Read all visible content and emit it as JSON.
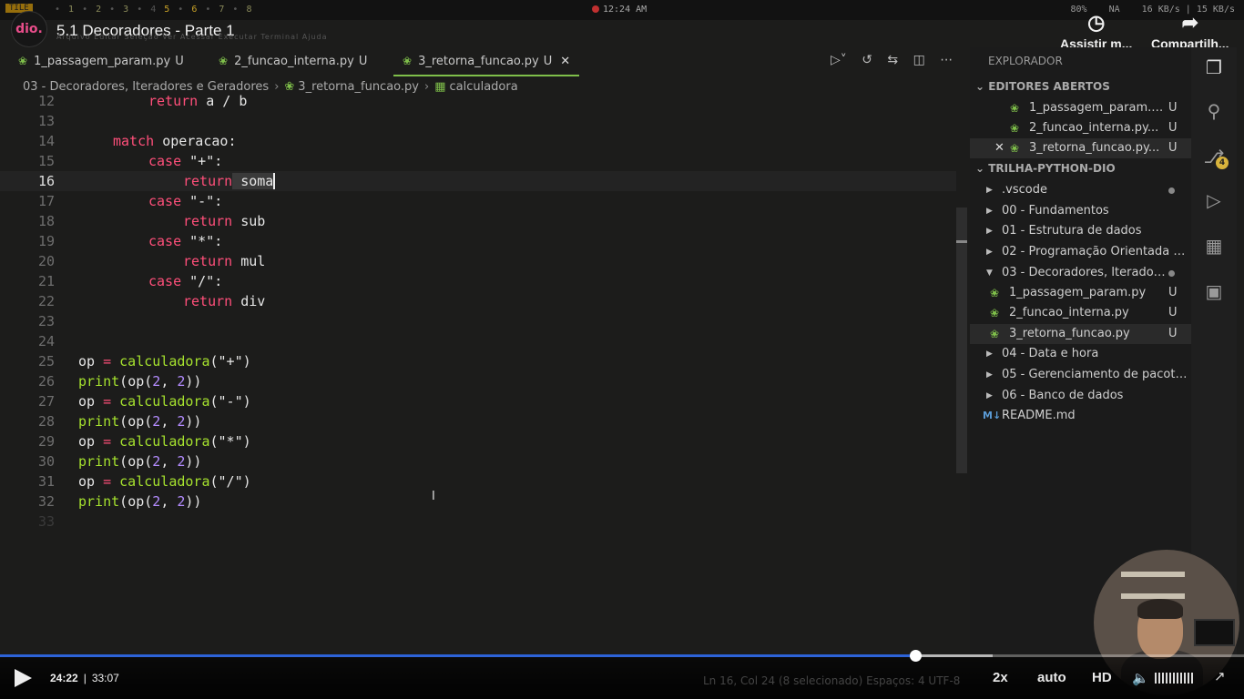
{
  "topbar": {
    "workspace_tag": "TILE",
    "workspaces": [
      "•",
      "1",
      "•",
      "2",
      "•",
      "3",
      "•",
      "4",
      "5",
      "•",
      "6",
      "•",
      "7",
      "•",
      "8"
    ],
    "clock": "12:24 AM",
    "cpu": "80%",
    "na": "NA",
    "net": "16 KB/s | 15 KB/s"
  },
  "video": {
    "title": "5.1 Decoradores - Parte 1",
    "ghost_menu": "Arquivo  Editar  Seleção  Ver  Acessar  Executar  Terminal  Ajuda",
    "watch_later": "Assistir m...",
    "share": "Compartilh..."
  },
  "tabs": [
    {
      "label": "1_passagem_param.py",
      "status": "U"
    },
    {
      "label": "2_funcao_interna.py",
      "status": "U"
    },
    {
      "label": "3_retorna_funcao.py",
      "status": "U",
      "close": "✕"
    }
  ],
  "breadcrumb": {
    "folder": "03 - Decoradores, Iteradores e Geradores",
    "file": "3_retorna_funcao.py",
    "symbol": "calculadora"
  },
  "code": {
    "line_numbers": [
      "12",
      "13",
      "14",
      "15",
      "16",
      "17",
      "18",
      "19",
      "20",
      "21",
      "22",
      "23",
      "24",
      "25",
      "26",
      "27",
      "28",
      "29",
      "30",
      "31",
      "32",
      "33"
    ],
    "kw_return": "return",
    "kw_match": "match",
    "kw_case": "case",
    "frag_12": " a / b",
    "var_operacao": "operacao",
    "colon": ":",
    "str_plus": "\"+\"",
    "str_minus": "\"-\"",
    "str_mul": "\"*\"",
    "str_div": "\"/\"",
    "name_soma": "soma",
    "name_sub": "sub",
    "name_mul": "mul",
    "name_div": "div",
    "var_op": "op",
    "eq": "=",
    "fn_calc": "calculadora",
    "fn_print": "print",
    "paren_open": "(",
    "paren_close": ")",
    "call_args_open": "op(",
    "num_2": "2",
    "comma": ", ",
    "close_2": "))"
  },
  "sidebar": {
    "title": "EXPLORADOR",
    "open_editors_title": "EDITORES ABERTOS",
    "open_editors": [
      {
        "label": "1_passagem_param.p...",
        "status": "U"
      },
      {
        "label": "2_funcao_interna.py...",
        "status": "U"
      },
      {
        "label": "3_retorna_funcao.py...",
        "status": "U",
        "close": "✕"
      }
    ],
    "project_title": "TRILHA-PYTHON-DIO",
    "tree": [
      {
        "label": ".vscode"
      },
      {
        "label": "00 - Fundamentos"
      },
      {
        "label": "01 - Estrutura de dados"
      },
      {
        "label": "02 - Programação Orientada a ..."
      },
      {
        "label": "03 - Decoradores, Iterador..."
      },
      {
        "label": "1_passagem_param.py",
        "status": "U"
      },
      {
        "label": "2_funcao_interna.py",
        "status": "U"
      },
      {
        "label": "3_retorna_funcao.py",
        "status": "U"
      },
      {
        "label": "04 - Data e hora"
      },
      {
        "label": "05 - Gerenciamento de pacotes ..."
      },
      {
        "label": "06 - Banco de dados"
      },
      {
        "label": "README.md"
      }
    ]
  },
  "activity": {
    "scm_badge": "4"
  },
  "player": {
    "current_time": "24:22",
    "separator": "|",
    "duration": "33:07",
    "progress": 0.7357,
    "buffered": 0.798,
    "speed": "2x",
    "quality": "auto",
    "hd": "HD",
    "status_ghost": "Ln 16, Col 24 (8 selecionado)    Espaços: 4    UTF-8"
  }
}
